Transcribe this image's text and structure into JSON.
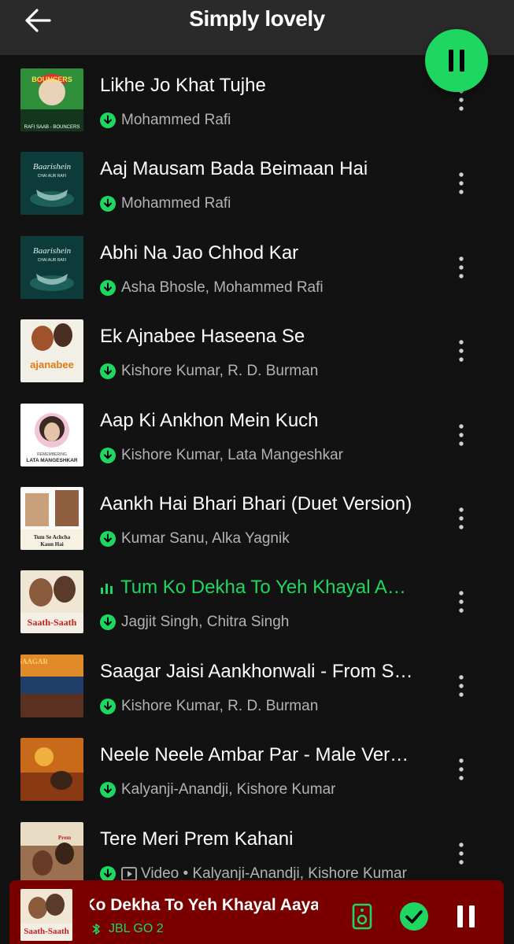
{
  "header": {
    "title": "Simply lovely"
  },
  "colors": {
    "accent": "#1ed760",
    "background": "#121212",
    "header": "#2a2a2a",
    "miniplayer": "#7a0000",
    "secondary_text": "#b3b3b3"
  },
  "tracks": [
    {
      "title": "Likhe Jo Khat Tujhe",
      "subtitle": "Mohammed Rafi",
      "cover_text": "BOUNCERS",
      "cover_caption": "RAFI SAAB - BOUNCERS",
      "playing": false
    },
    {
      "title": "Aaj Mausam Bada Beimaan Hai",
      "subtitle": "Mohammed Rafi",
      "cover_text": "Baarishein",
      "cover_caption": "CHAI AUR RAFI",
      "playing": false
    },
    {
      "title": "Abhi Na Jao Chhod Kar",
      "subtitle": "Asha Bhosle, Mohammed Rafi",
      "cover_text": "Baarishein",
      "cover_caption": "CHAI AUR RAFI",
      "playing": false
    },
    {
      "title": "Ek Ajnabee Haseena Se",
      "subtitle": "Kishore Kumar, R. D. Burman",
      "cover_text": "ajanabee",
      "cover_caption": "",
      "playing": false
    },
    {
      "title": "Aap Ki Ankhon Mein Kuch",
      "subtitle": "Kishore Kumar, Lata Mangeshkar",
      "cover_text": "LATA MANGESHKAR",
      "cover_caption": "REMEMBERING",
      "playing": false
    },
    {
      "title": "Aankh Hai Bhari Bhari (Duet Version)",
      "subtitle": "Kumar Sanu, Alka Yagnik",
      "cover_text": "Tum Se Achcha Kaun Hai",
      "cover_caption": "",
      "playing": false
    },
    {
      "title": "Tum Ko Dekha To Yeh Khayal Aaya",
      "subtitle": "Jagjit Singh, Chitra Singh",
      "cover_text": "Saath-Saath",
      "cover_caption": "",
      "playing": true
    },
    {
      "title": "Saagar Jaisi Aankhonwali - From Saagar",
      "subtitle": "Kishore Kumar, R. D. Burman",
      "cover_text": "SAAGAR",
      "cover_caption": "",
      "playing": false
    },
    {
      "title": "Neele Neele Ambar Par - Male Version",
      "subtitle": "Kalyanji-Anandji, Kishore Kumar",
      "cover_text": "",
      "cover_caption": "",
      "playing": false
    },
    {
      "title": "Tere Meri Prem Kahani",
      "subtitle": "Video • Kalyanji-Anandji, Kishore Kumar",
      "cover_text": "",
      "cover_caption": "",
      "playing": false,
      "video": true
    }
  ],
  "miniplayer": {
    "title": "Tum Ko Dekha To Yeh Khayal Aaya",
    "device": "JBL GO 2",
    "cover_text": "Saath-Saath"
  },
  "icons": {
    "back": "arrow-left-icon",
    "play_state": "pause-icon",
    "download": "download-icon",
    "more": "more-vertical-icon",
    "device": "speaker-icon",
    "saved": "check-icon",
    "bluetooth": "bluetooth-icon"
  }
}
